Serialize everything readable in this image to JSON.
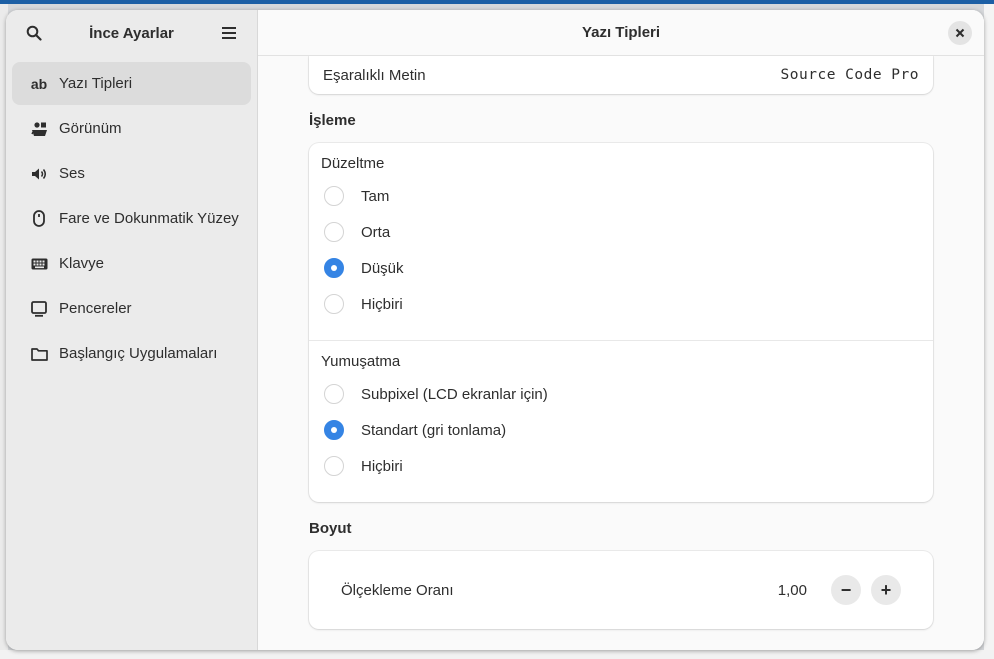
{
  "sidebar": {
    "title": "İnce Ayarlar",
    "items": [
      {
        "label": "Yazı Tipleri",
        "icon": "ab"
      },
      {
        "label": "Görünüm",
        "icon": "appearance-icon"
      },
      {
        "label": "Ses",
        "icon": "speaker-icon"
      },
      {
        "label": "Fare ve Dokunmatik Yüzey",
        "icon": "mouse-icon"
      },
      {
        "label": "Klavye",
        "icon": "keyboard-icon"
      },
      {
        "label": "Pencereler",
        "icon": "window-icon"
      },
      {
        "label": "Başlangıç Uygulamaları",
        "icon": "folder-icon"
      }
    ]
  },
  "main": {
    "title": "Yazı Tipleri",
    "monospace": {
      "label": "Eşaralıklı Metin",
      "value": "Source Code Pro"
    },
    "rendering": {
      "section_title": "İşleme",
      "hinting": {
        "title": "Düzeltme",
        "options": [
          "Tam",
          "Orta",
          "Düşük",
          "Hiçbiri"
        ],
        "selected": "Düşük"
      },
      "antialiasing": {
        "title": "Yumuşatma",
        "options": [
          "Subpixel (LCD ekranlar için)",
          "Standart (gri tonlama)",
          "Hiçbiri"
        ],
        "selected": "Standart (gri tonlama)"
      }
    },
    "size": {
      "section_title": "Boyut",
      "scaling_label": "Ölçekleme Oranı",
      "scaling_value": "1,00",
      "decrement": "−",
      "increment": "+"
    }
  },
  "colors": {
    "accent": "#3584e4",
    "sidebar_bg": "#ebebeb",
    "active_item": "#dcdcdc"
  }
}
